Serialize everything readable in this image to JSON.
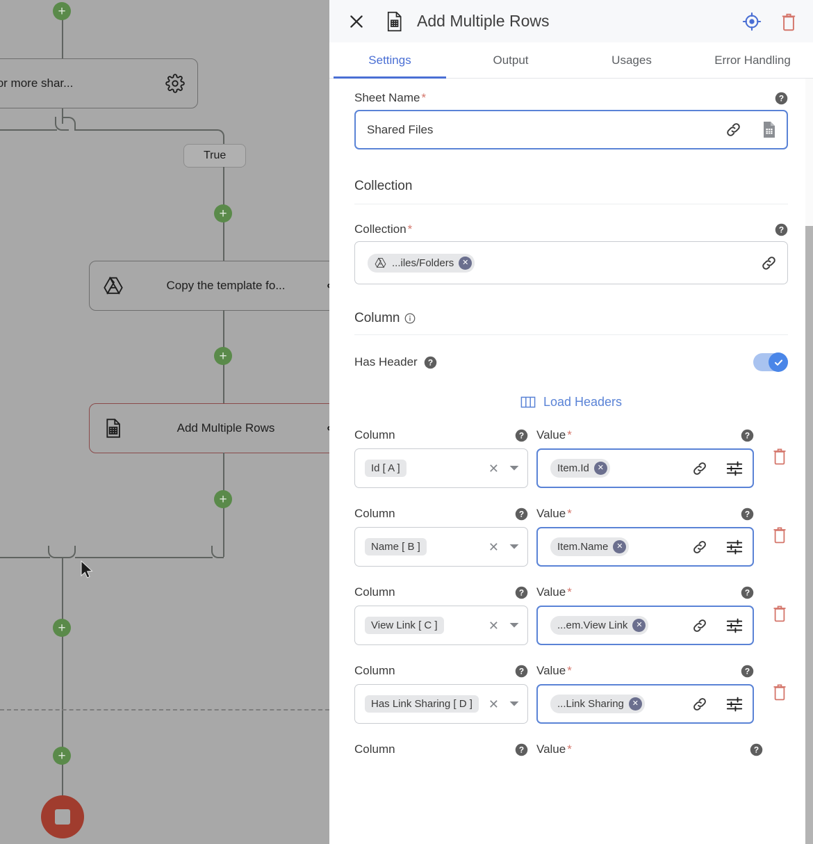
{
  "canvas": {
    "nodes": [
      {
        "label": "Has one or more shar...",
        "icon": "none"
      },
      {
        "label": "Copy the template fo...",
        "icon": "google-drive-icon"
      },
      {
        "label": "Add Multiple Rows",
        "icon": "google-sheets-icon"
      }
    ],
    "branch_chip": "True",
    "stop_label": "stop-node"
  },
  "panel": {
    "header": {
      "title": "Add Multiple Rows",
      "close_icon": "close-icon",
      "app_icon": "google-sheets-icon",
      "target_icon": "target-icon",
      "delete_icon": "trash-icon"
    },
    "tabs": [
      {
        "label": "Settings",
        "active": true
      },
      {
        "label": "Output",
        "active": false
      },
      {
        "label": "Usages",
        "active": false
      },
      {
        "label": "Error Handling",
        "active": false
      }
    ],
    "sheet_name": {
      "label": "Sheet Name",
      "required": "*",
      "value": "Shared Files",
      "link_icon": "link-icon",
      "picker_icon": "google-sheets-icon"
    },
    "collection_section": {
      "title": "Collection",
      "label": "Collection",
      "required": "*",
      "chip": "...iles/Folders",
      "chip_icon": "google-drive-icon",
      "link_icon": "link-icon"
    },
    "column_section": {
      "title": "Column",
      "info_icon": "info-icon",
      "has_header_label": "Has Header",
      "has_header_value": "on",
      "load_headers_label": "Load Headers",
      "load_headers_icon": "columns-icon"
    },
    "col_row_labels": {
      "column": "Column",
      "value": "Value",
      "required": "*"
    },
    "rows": [
      {
        "column": "Id [ A ]",
        "value": "Item.Id"
      },
      {
        "column": "Name [ B ]",
        "value": "Item.Name"
      },
      {
        "column": "View Link [ C ]",
        "value": "...em.View Link"
      },
      {
        "column": "Has Link Sharing [ D ]",
        "value": "...Link Sharing"
      }
    ],
    "partial_row": {
      "column": "Column",
      "value": "Value",
      "required": "*"
    }
  },
  "colors": {
    "accent_blue": "#4a6fd4",
    "field_focus": "#5a83d6",
    "required_red": "#d4756a",
    "danger_red": "#d4756a",
    "toggle_on": "#4a86e8",
    "canvas_bg": "#a8a8a8",
    "plus_green": "#5a8a4a",
    "stop_red": "#a03c2e",
    "selected_node": "#8a4a4a"
  }
}
